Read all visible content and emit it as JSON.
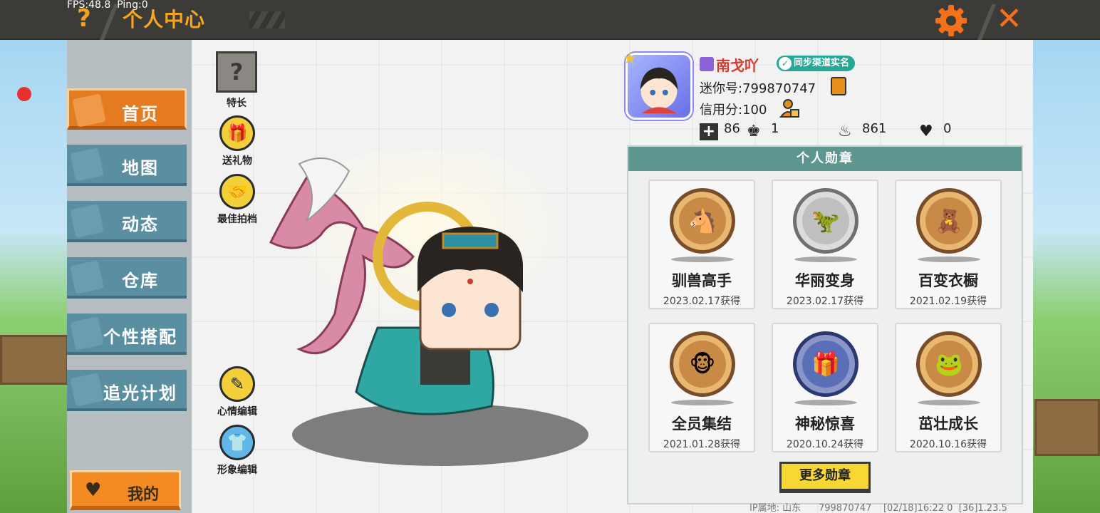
{
  "status": {
    "fps": "FPS:48.8",
    "ping": "Ping:0"
  },
  "header": {
    "title": "个人中心",
    "help_icon": "question-icon",
    "settings_icon": "gear-icon",
    "close_icon": "close-icon"
  },
  "sidebar": {
    "items": [
      {
        "label": "首页",
        "icon": "home-icon",
        "active": true
      },
      {
        "label": "地图",
        "icon": "map-icon"
      },
      {
        "label": "动态",
        "icon": "bell-icon"
      },
      {
        "label": "仓库",
        "icon": "warehouse-icon"
      },
      {
        "label": "个性搭配",
        "icon": "outfit-icon"
      },
      {
        "label": "追光计划",
        "icon": "camera-icon"
      }
    ],
    "mine_label": "我的"
  },
  "side_buttons": {
    "talent": "特长",
    "gift": "送礼物",
    "partner": "最佳拍档",
    "mood_edit": "心情编辑",
    "look_edit": "形象编辑"
  },
  "profile": {
    "name": "南戈吖",
    "sync_label": "同步渠道实名",
    "mini_id": "迷你号:799870747",
    "credit": "信用分:100",
    "stats": {
      "follows": "86",
      "fans": "1",
      "heat": "861",
      "likes": "0"
    }
  },
  "badges": {
    "title": "个人勋章",
    "items": [
      {
        "name": "驯兽高手",
        "date": "2023.02.17获得",
        "glyph": "🐴",
        "ring": "#c88a46"
      },
      {
        "name": "华丽变身",
        "date": "2023.02.17获得",
        "glyph": "🦖",
        "ring": "#a8a8a8"
      },
      {
        "name": "百变衣橱",
        "date": "2021.02.19获得",
        "glyph": "🧸",
        "ring": "#c88a46"
      },
      {
        "name": "全员集结",
        "date": "2021.01.28获得",
        "glyph": "🐵",
        "ring": "#c88a46"
      },
      {
        "name": "神秘惊喜",
        "date": "2020.10.24获得",
        "glyph": "🎁",
        "ring": "#4a5fa8"
      },
      {
        "name": "茁壮成长",
        "date": "2020.10.16获得",
        "glyph": "🐸",
        "ring": "#c88a46"
      }
    ],
    "more_label": "更多勋章"
  },
  "footer": {
    "ip": "IP属地: 山东",
    "id": "799870747",
    "time": "[02/18]16:22 0",
    "ver": "[36]1.23.5"
  }
}
